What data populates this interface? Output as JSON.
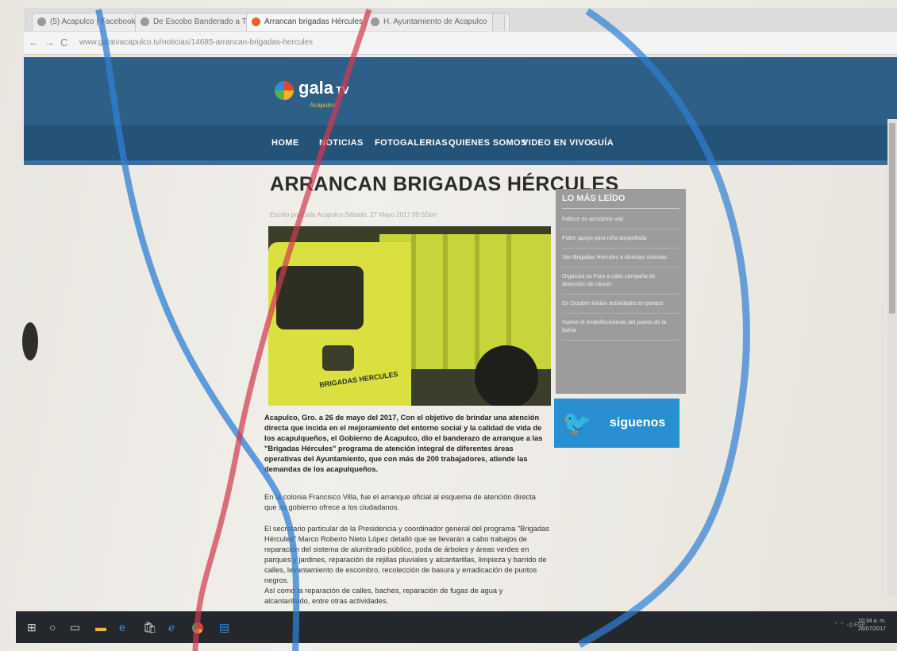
{
  "browser": {
    "tabs": [
      {
        "label": "(5) Acapulco | Facebook",
        "active": false
      },
      {
        "label": "De Escobo Banderado a T",
        "active": false
      },
      {
        "label": "Arrancan brigadas Hércules",
        "active": true
      },
      {
        "label": "H. Ayuntamiento de Acapulco",
        "active": false
      }
    ],
    "url": "www.galatvacapulco.tv/noticias/14685-arrancan-brigadas-hercules"
  },
  "site": {
    "logo": "gala",
    "logo_tv": "TV",
    "logo_sub": "Acapulco",
    "nav": [
      "HOME",
      "NOTICIAS",
      "FOTOGALERIAS",
      "QUIENES SOMOS",
      "VIDEO EN VIVO",
      "GUÍA"
    ]
  },
  "article": {
    "title": "ARRANCAN BRIGADAS HÉRCULES",
    "byline": "Escrito por Gala Acapulco     Sábado, 27 Mayo 2017 09:02am",
    "image_text": "BRIGADAS HERCULES",
    "lead": "Acapulco, Gro. a 26 de mayo del 2017,  Con el objetivo de brindar una atención directa que incida en el mejoramiento del entorno social y la calidad de vida de los acapulqueños,  el Gobierno de Acapulco, dio el banderazo de arranque a las \"Brigadas Hércules\" programa de atención integral de diferentes áreas operativas del Ayuntamiento, que con más de 200 trabajadores, atiende las demandas de los acapulqueños.",
    "p1": "En la colonia Francisco Villa, fue el arranque oficial al esquema de atención directa que su gobierno ofrece a los ciudadanos.",
    "p2": "El secretario particular de la Presidencia y coordinador general del programa \"Brigadas Hércules\" Marco Roberto Nieto López detalló que se llevarán a cabo trabajos de reparación del sistema de alumbrado público,  poda de árboles y áreas verdes en parques y jardines, reparación de rejillas pluviales y alcantarillas, limpieza y barrido de calles, levantamiento de escombro, recolección de basura y erradicación de puntos negros.",
    "p3": "Así como la reparación de calles, baches, reparación de fugas de agua y alcantarillado, entre otras actividades."
  },
  "sidebar": {
    "title": "LO MÁS LEÍDO",
    "items": [
      "Fallece en accidente vial",
      "Piden apoyo para niña atropellada",
      "Van Brigadas Hércules a distintas colonias",
      "Organiza su Fora a cabo campaña de detección de cáncer",
      "En Octubre inician actividades en parque",
      "Vuelve el embellecimiento del puerto de la bahía"
    ],
    "follow": "siguenos"
  },
  "taskbar": {
    "time": "10:34 a. m.",
    "date": "26/07/2017",
    "lang": "ESP"
  }
}
